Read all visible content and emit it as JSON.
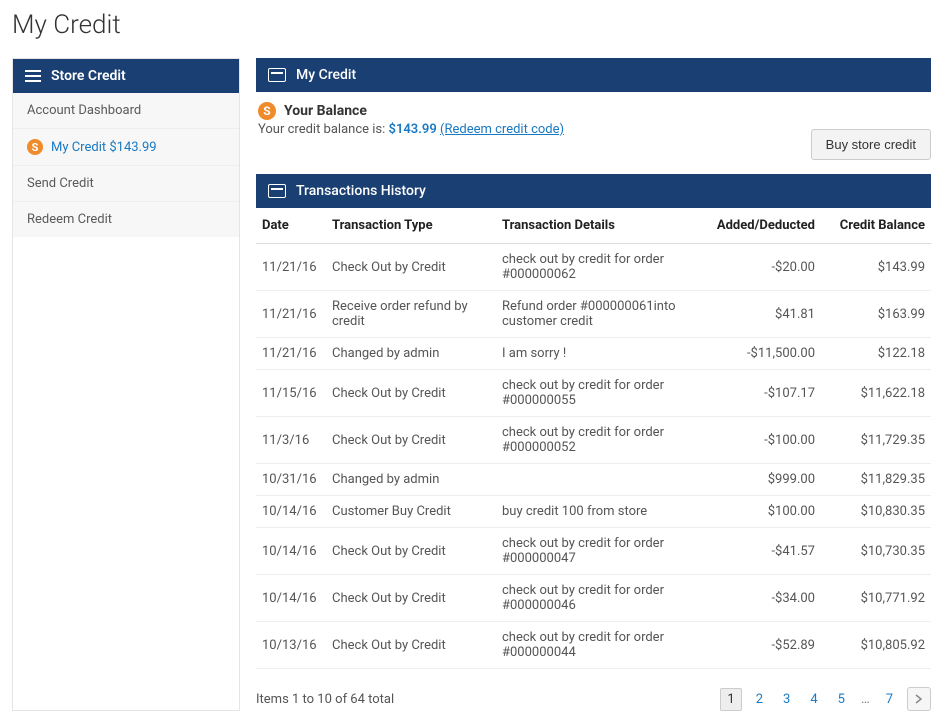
{
  "page_title": "My Credit",
  "sidebar": {
    "header": "Store Credit",
    "items": [
      {
        "label": "Account Dashboard",
        "icon": null,
        "active": false
      },
      {
        "label": "My Credit $143.99",
        "icon": "coin",
        "active": true
      },
      {
        "label": "Send Credit",
        "icon": null,
        "active": false
      },
      {
        "label": "Redeem Credit",
        "icon": null,
        "active": false
      }
    ]
  },
  "my_credit": {
    "header": "My Credit",
    "balance_title": "Your Balance",
    "balance_prefix": "Your credit balance is: ",
    "balance_amount": "$143.99",
    "redeem_link": "(Redeem credit code)"
  },
  "buy_button": "Buy store credit",
  "history": {
    "header": "Transactions History",
    "columns": {
      "date": "Date",
      "type": "Transaction Type",
      "details": "Transaction Details",
      "amount": "Added/Deducted",
      "balance": "Credit Balance"
    },
    "rows": [
      {
        "date": "11/21/16",
        "type": "Check Out by Credit",
        "details": "check out by credit for order #000000062",
        "amount": "-$20.00",
        "balance": "$143.99"
      },
      {
        "date": "11/21/16",
        "type": "Receive order refund by credit",
        "details": "Refund order #000000061into customer credit",
        "amount": "$41.81",
        "balance": "$163.99"
      },
      {
        "date": "11/21/16",
        "type": "Changed by admin",
        "details": "I am sorry !",
        "amount": "-$11,500.00",
        "balance": "$122.18"
      },
      {
        "date": "11/15/16",
        "type": "Check Out by Credit",
        "details": "check out by credit for order #000000055",
        "amount": "-$107.17",
        "balance": "$11,622.18"
      },
      {
        "date": "11/3/16",
        "type": "Check Out by Credit",
        "details": "check out by credit for order #000000052",
        "amount": "-$100.00",
        "balance": "$11,729.35"
      },
      {
        "date": "10/31/16",
        "type": "Changed by admin",
        "details": "",
        "amount": "$999.00",
        "balance": "$11,829.35"
      },
      {
        "date": "10/14/16",
        "type": "Customer Buy Credit",
        "details": "buy credit 100 from store",
        "amount": "$100.00",
        "balance": "$10,830.35"
      },
      {
        "date": "10/14/16",
        "type": "Check Out by Credit",
        "details": "check out by credit for order #000000047",
        "amount": "-$41.57",
        "balance": "$10,730.35"
      },
      {
        "date": "10/14/16",
        "type": "Check Out by Credit",
        "details": "check out by credit for order #000000046",
        "amount": "-$34.00",
        "balance": "$10,771.92"
      },
      {
        "date": "10/13/16",
        "type": "Check Out by Credit",
        "details": "check out by credit for order #000000044",
        "amount": "-$52.89",
        "balance": "$10,805.92"
      }
    ]
  },
  "footer": {
    "items_text": "Items 1 to 10 of 64 total",
    "pages": [
      "1",
      "2",
      "3",
      "4",
      "5"
    ],
    "last_page": "7",
    "current_page": "1"
  }
}
